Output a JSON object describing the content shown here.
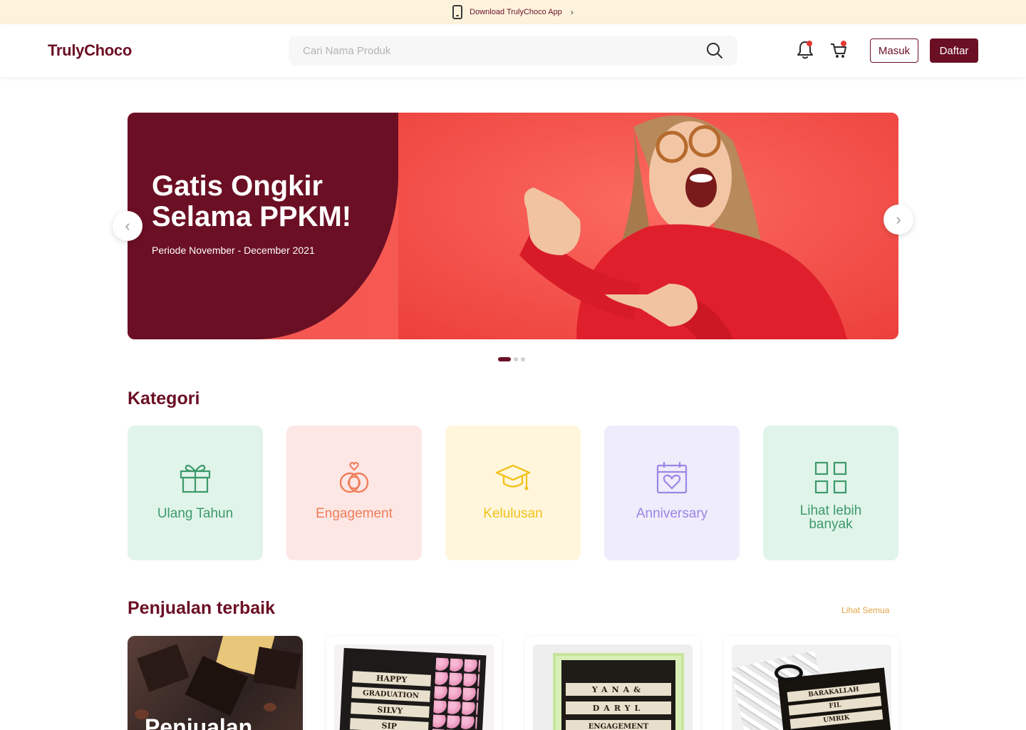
{
  "promo": {
    "text": "Download TrulyChoco App",
    "icon": "phone-icon"
  },
  "header": {
    "logo": "TrulyChoco",
    "search_placeholder": "Cari Nama Produk",
    "login_label": "Masuk",
    "register_label": "Daftar"
  },
  "banner": {
    "title": "Gatis Ongkir Selama PPKM!",
    "subtitle": "Periode November - December 2021",
    "slides_total": 3,
    "active_slide": 1
  },
  "categories": {
    "title": "Kategori",
    "items": [
      {
        "label": "Ulang Tahun",
        "icon": "gift-icon",
        "bg": "#e1f4ea",
        "color": "#3c9a6a"
      },
      {
        "label": "Engagement",
        "icon": "rings-icon",
        "bg": "#fde7e5",
        "color": "#f07c5a"
      },
      {
        "label": "Kelulusan",
        "icon": "graduation-cap-icon",
        "bg": "#fff6dc",
        "color": "#f2c21b"
      },
      {
        "label": "Anniversary",
        "icon": "calendar-heart-icon",
        "bg": "#efecfb",
        "color": "#9b86e6"
      },
      {
        "label": "Lihat lebih banyak",
        "icon": "grid-icon",
        "bg": "#e1f4ea",
        "color": "#3c9a6a"
      }
    ]
  },
  "bestseller": {
    "title": "Penjualan terbaik",
    "see_all": "Lihat Semua",
    "card1_text": "Penjualan",
    "card2_rows": [
      "HAPPY",
      "GRADUATION",
      "SILVY",
      "SIP"
    ],
    "card3_rows": [
      "YANA&",
      "DARYL",
      "ENGAGEMENT"
    ],
    "card4_rows": [
      "BARAKALLAH",
      "FIL",
      "UMRIK"
    ]
  },
  "colors": {
    "brand": "#6b0f24",
    "accent": "#e3a449",
    "banner": "#f2544e"
  }
}
